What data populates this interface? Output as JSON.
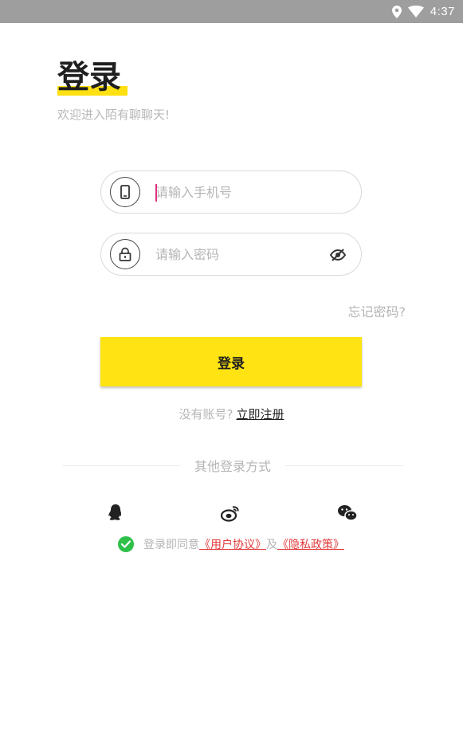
{
  "status_bar": {
    "time": "4:37",
    "icons": [
      "location-icon",
      "wifi-icon"
    ]
  },
  "header": {
    "title": "登录",
    "subtitle": "欢迎进入陌有聊聊天!"
  },
  "form": {
    "phone_placeholder": "请输入手机号",
    "phone_value": "",
    "password_placeholder": "请输入密码",
    "password_value": "",
    "forgot_label": "忘记密码?",
    "login_button": "登录"
  },
  "register": {
    "prompt": "没有账号?",
    "link": "立即注册"
  },
  "other_login": {
    "label": "其他登录方式",
    "providers": [
      "qq-icon",
      "weibo-icon",
      "wechat-icon"
    ]
  },
  "agreement": {
    "prefix": "登录即同意",
    "user_agreement": "《用户协议》",
    "and": "及",
    "privacy_policy": "《隐私政策》",
    "checked": true
  },
  "colors": {
    "accent_yellow": "#ffe312",
    "link_red": "#e23b3b",
    "check_green": "#2fc04a",
    "status_bar": "#9e9e9e"
  }
}
